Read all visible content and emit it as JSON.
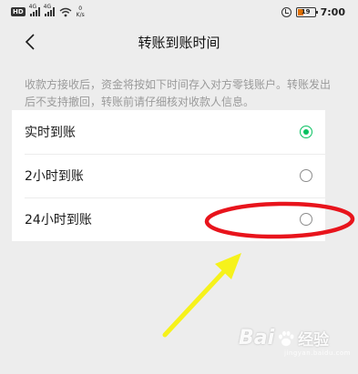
{
  "status_bar": {
    "hd_label": "HD",
    "sim1_label": "4G",
    "sim2_label": "4G",
    "speed_value": "0",
    "speed_unit": "K/s",
    "battery_level": "19",
    "time": "7:00"
  },
  "nav": {
    "title": "转账到账时间",
    "back_icon": "chevron-left-icon"
  },
  "notice": {
    "text": "收款方接收后，资金将按如下时间存入对方零钱账户。转账发出后不支持撤回，转账前请仔细核对收款人信息。"
  },
  "options": [
    {
      "label": "实时到账",
      "selected": true
    },
    {
      "label": "2小时到账",
      "selected": false
    },
    {
      "label": "24小时到账",
      "selected": false
    }
  ],
  "colors": {
    "accent_green": "#07c160",
    "annotation_red": "#e8141c",
    "annotation_yellow": "#f6f21b"
  },
  "watermark": {
    "brand_left": "Bai",
    "brand_right": "经验",
    "sub": "jingyan.baidu.com"
  }
}
